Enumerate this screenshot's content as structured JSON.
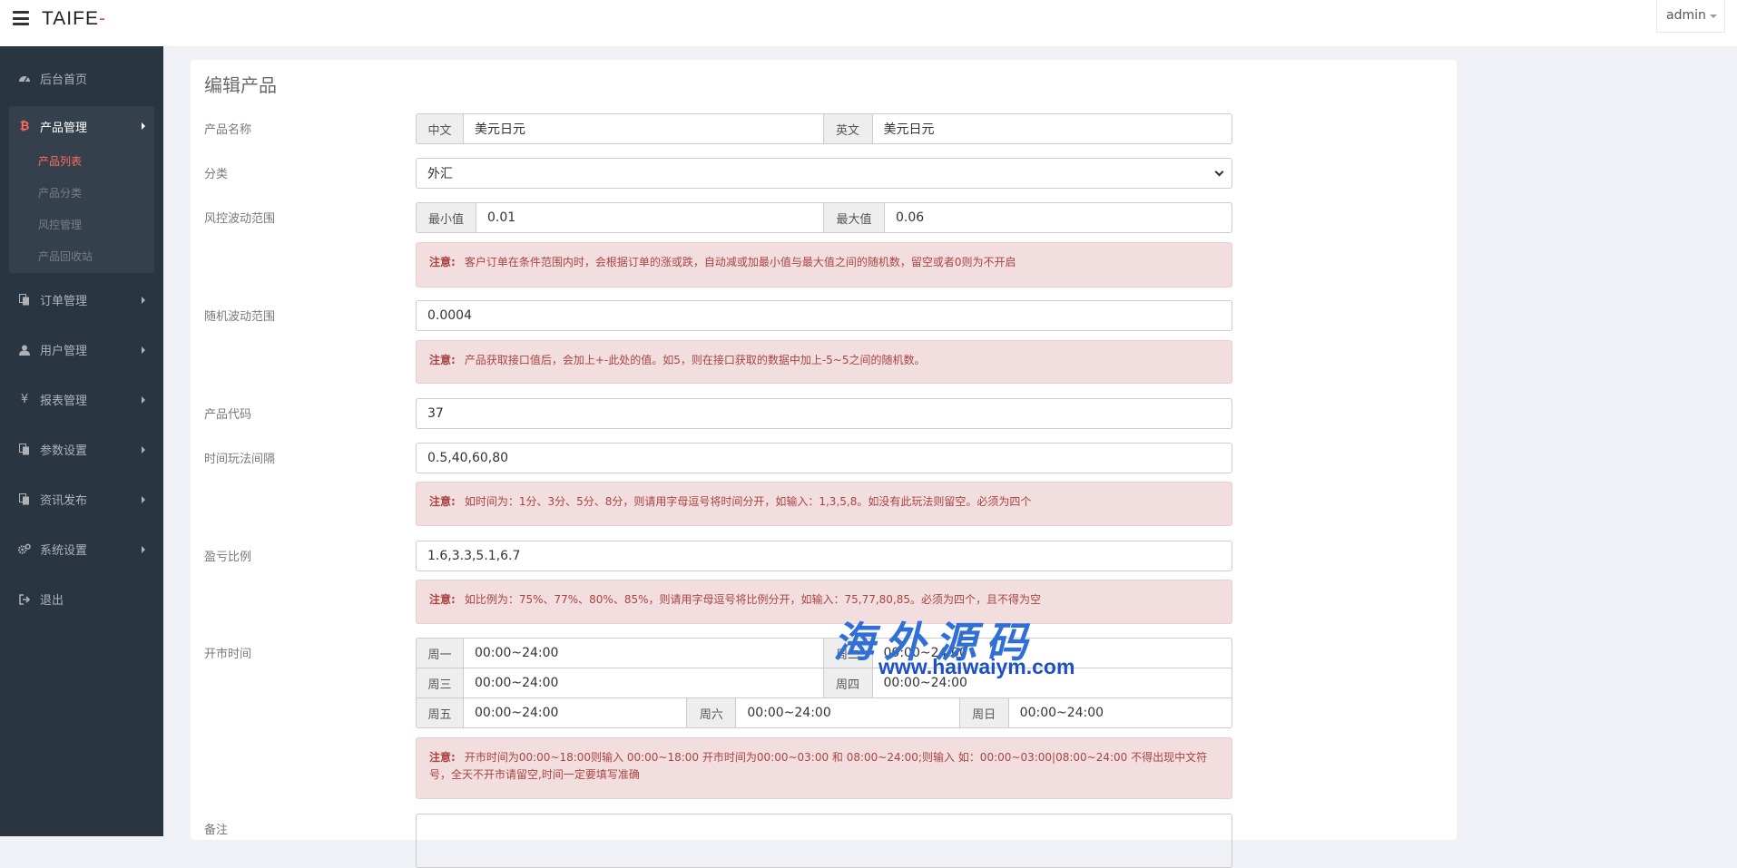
{
  "header": {
    "logo_text": "TAIFE",
    "logo_dash": "-",
    "user": "admin"
  },
  "sidebar": {
    "items": [
      {
        "label": "后台首页",
        "icon": "dashboard-icon"
      },
      {
        "label": "产品管理",
        "icon": "bitcoin-icon",
        "expanded": true,
        "children": [
          "产品列表",
          "产品分类",
          "风控管理",
          "产品回收站"
        ],
        "active_child": "产品列表"
      },
      {
        "label": "订单管理",
        "icon": "copy-icon"
      },
      {
        "label": "用户管理",
        "icon": "user-icon"
      },
      {
        "label": "报表管理",
        "icon": "yen-icon"
      },
      {
        "label": "参数设置",
        "icon": "copy-icon"
      },
      {
        "label": "资讯发布",
        "icon": "copy-icon"
      },
      {
        "label": "系统设置",
        "icon": "gears-icon"
      },
      {
        "label": "退出",
        "icon": "sign-out-icon"
      }
    ]
  },
  "form": {
    "title": "编辑产品",
    "name": {
      "label": "产品名称",
      "cn_addon": "中文",
      "cn_value": "美元日元",
      "en_addon": "英文",
      "en_value": "美元日元"
    },
    "category": {
      "label": "分类",
      "value": "外汇"
    },
    "risk": {
      "label": "风控波动范围",
      "min_addon": "最小值",
      "min_value": "0.01",
      "max_addon": "最大值",
      "max_value": "0.06",
      "note_title": "注意:",
      "note": "客户订单在条件范围内时，会根据订单的涨或跌，自动减或加最小值与最大值之间的随机数，留空或者0则为不开启"
    },
    "random": {
      "label": "随机波动范围",
      "value": "0.0004",
      "note_title": "注意:",
      "note": "产品获取接口值后，会加上+-此处的值。如5，则在接口获取的数据中加上-5~5之间的随机数。"
    },
    "code": {
      "label": "产品代码",
      "value": "37"
    },
    "interval": {
      "label": "时间玩法间隔",
      "value": "0.5,40,60,80",
      "note_title": "注意:",
      "note": "如时间为：1分、3分、5分、8分，则请用字母逗号将时间分开，如输入：1,3,5,8。如没有此玩法则留空。必须为四个"
    },
    "ratio": {
      "label": "盈亏比例",
      "value": "1.6,3.3,5.1,6.7",
      "note_title": "注意:",
      "note": "如比例为：75%、77%、80%、85%，则请用字母逗号将比例分开，如输入：75,77,80,85。必须为四个，且不得为空"
    },
    "market": {
      "label": "开市时间",
      "days": [
        {
          "day": "周一",
          "time": "00:00~24:00"
        },
        {
          "day": "周二",
          "time": "00:00~24:00"
        },
        {
          "day": "周三",
          "time": "00:00~24:00"
        },
        {
          "day": "周四",
          "time": "00:00~24:00"
        },
        {
          "day": "周五",
          "time": "00:00~24:00"
        },
        {
          "day": "周六",
          "time": "00:00~24:00"
        },
        {
          "day": "周日",
          "time": "00:00~24:00"
        }
      ],
      "note_title": "注意:",
      "note": "开市时间为00:00~18:00则输入 00:00~18:00 开市时间为00:00~03:00 和 08:00~24:00;则输入 如：00:00~03:00|08:00~24:00 不得出现中文符号，全天不开市请留空,时间一定要填写准确"
    },
    "remark": {
      "label": "备注",
      "value": ""
    }
  },
  "watermark": {
    "cn": "海外源码",
    "url": "www.haiwaiym.com"
  }
}
